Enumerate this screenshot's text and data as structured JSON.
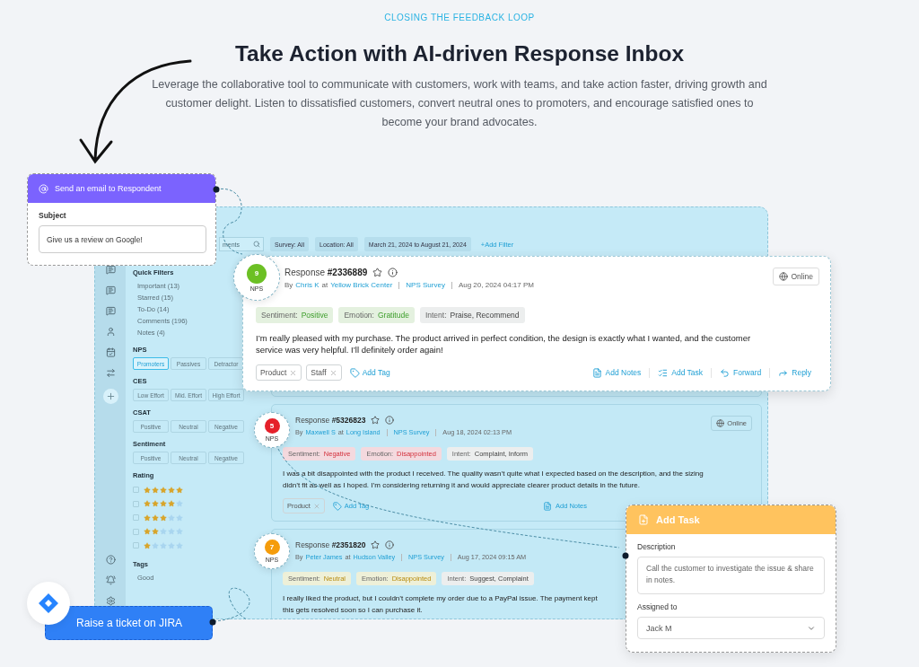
{
  "header": {
    "eyebrow": "CLOSING THE FEEDBACK LOOP",
    "title": "Take Action with AI-driven Response Inbox",
    "description": "Leverage the collaborative tool to communicate with customers, work with teams, and take action faster, driving growth and customer delight. Listen to dissatisfied customers, convert neutral ones to promoters, and encourage satisfied ones to become your brand advocates."
  },
  "filter_bar": {
    "search_text": "ments",
    "chips": [
      "Survey: All",
      "Location: All",
      "March 21, 2024 to August 21, 2024"
    ],
    "add_filter": "+Add Filter"
  },
  "sidebar": [
    {
      "kind": "list",
      "title": "Quick Filters",
      "items": [
        "Important (13)",
        "Starred (15)",
        "To-Do (14)",
        "Comments (196)",
        "Notes (4)"
      ]
    },
    {
      "kind": "chips",
      "title": "NPS",
      "options": [
        {
          "label": "Promoters",
          "selected": true
        },
        {
          "label": "Passives",
          "selected": false
        },
        {
          "label": "Detractor",
          "selected": false
        }
      ]
    },
    {
      "kind": "chips",
      "title": "CES",
      "options": [
        {
          "label": "Low Effort",
          "selected": false
        },
        {
          "label": "Mid. Effort",
          "selected": false
        },
        {
          "label": "High Effort",
          "selected": false
        }
      ]
    },
    {
      "kind": "chips",
      "title": "CSAT",
      "options": [
        {
          "label": "Positive",
          "selected": false
        },
        {
          "label": "Neutral",
          "selected": false
        },
        {
          "label": "Negative",
          "selected": false
        }
      ]
    },
    {
      "kind": "chips",
      "title": "Sentiment",
      "options": [
        {
          "label": "Positive",
          "selected": false
        },
        {
          "label": "Neutral",
          "selected": false
        },
        {
          "label": "Negative",
          "selected": false
        }
      ]
    },
    {
      "kind": "rating",
      "title": "Rating",
      "rows": [
        {
          "stars": 5,
          "checked": false
        },
        {
          "stars": 4,
          "checked": false
        },
        {
          "stars": 3,
          "checked": false
        },
        {
          "stars": 2,
          "checked": false
        },
        {
          "stars": 1,
          "checked": false
        }
      ]
    },
    {
      "kind": "list",
      "title": "Tags",
      "items": [
        "Good"
      ]
    }
  ],
  "responses": [
    {
      "score": "9",
      "score_label": "NPS",
      "color": "#6cc024",
      "title": "Response **#2336889**",
      "by": "By",
      "author": "Chris K",
      "at": "at",
      "location": "Yellow Brick Center",
      "survey": "NPS Survey",
      "date": "Aug 20, 2024 04:17 PM",
      "channel": "Online",
      "insights": [
        {
          "label": "Sentiment:",
          "value": "Positive",
          "kind": "positive"
        },
        {
          "label": "Emotion:",
          "value": "Gratitude",
          "kind": "positive"
        },
        {
          "label": "Intent:",
          "value": "Praise, Recommend",
          "kind": "plain"
        }
      ],
      "text": "I’m really pleased with my purchase. The product arrived in perfect condition, the design is exactly what I wanted, and the customer\nservice was very helpful. I’ll definitely order again!",
      "tags": [
        "Product",
        "Staff"
      ],
      "add_tag": "Add Tag",
      "actions": [
        {
          "kind": "notes",
          "label": "Add Notes"
        },
        {
          "kind": "task",
          "label": "Add Task"
        },
        {
          "kind": "forward",
          "label": "Forward"
        },
        {
          "kind": "reply",
          "label": "Reply"
        }
      ]
    },
    {
      "score": "5",
      "score_label": "NPS",
      "color": "#e5202a",
      "title": "Response **#5326823**",
      "by": "By",
      "author": "Maxwell S",
      "at": "at",
      "location": "Long Island",
      "survey": "NPS Survey",
      "date": "Aug 18, 2024 02:13 PM",
      "channel": "Online",
      "insights": [
        {
          "label": "Sentiment:",
          "value": "Negative",
          "kind": "negative"
        },
        {
          "label": "Emotion:",
          "value": "Disappointed",
          "kind": "negative"
        },
        {
          "label": "Intent:",
          "value": "Complaint, Inform",
          "kind": "plain"
        }
      ],
      "text": "I was a bit disappointed with the product I received. The quality wasn’t quite what I expected based on the description, and the sizing\ndidn’t fit as well as I hoped. I’m considering returning it and would appreciate clearer product details in the future.",
      "tags": [
        "Product"
      ],
      "add_tag": "Add Tag",
      "actions": [
        {
          "kind": "notes",
          "label": "Add Notes"
        }
      ]
    },
    {
      "score": "7",
      "score_label": "NPS",
      "color": "#f59c0b",
      "title": "Response **#2351820**",
      "by": "By",
      "author": "Peter James",
      "at": "at",
      "location": "Hudson Valley",
      "survey": "NPS Survey",
      "date": "Aug 17, 2024 09:15 AM",
      "insights": [
        {
          "label": "Sentiment:",
          "value": "Neutral",
          "kind": "neutral"
        },
        {
          "label": "Emotion:",
          "value": "Disappointed",
          "kind": "neutral"
        },
        {
          "label": "Intent:",
          "value": "Suggest, Complaint",
          "kind": "plain"
        }
      ],
      "text": "I really liked the product, but I couldn’t complete my order due to a PayPal issue. The payment kept\nthis gets resolved soon so I can purchase it."
    }
  ],
  "email_card": {
    "title": "Send an email to Respondent",
    "label": "Subject",
    "value": "Give us a review on Google!"
  },
  "task_card": {
    "title": "Add Task",
    "description_label": "Description",
    "description": "Call the customer to investigate the issue & share in notes.",
    "assignee_label": "Assigned to",
    "assignee": "Jack M"
  },
  "jira": {
    "label": "Raise a ticket on JIRA"
  }
}
